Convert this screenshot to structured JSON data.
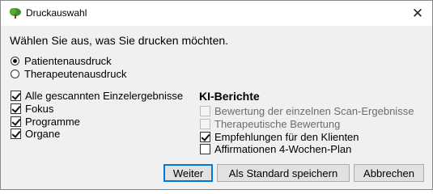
{
  "window": {
    "title": "Druckauswahl",
    "close_symbol": "✕",
    "app_icon": "green-cloud-icon"
  },
  "prompt": "Wählen Sie aus, was Sie drucken möchten.",
  "print_type": {
    "options": [
      {
        "label": "Patientenausdruck",
        "selected": true
      },
      {
        "label": "Therapeutenausdruck",
        "selected": false
      }
    ]
  },
  "left_options": [
    {
      "label": "Alle gescannten Einzelergebnisse",
      "checked": true
    },
    {
      "label": "Fokus",
      "checked": true
    },
    {
      "label": "Programme",
      "checked": true
    },
    {
      "label": "Organe",
      "checked": true
    }
  ],
  "ki_reports": {
    "heading": "KI-Berichte",
    "items": [
      {
        "label": "Bewertung der einzelnen Scan-Ergebnisse",
        "checked": false,
        "enabled": false
      },
      {
        "label": "Therapeutische Bewertung",
        "checked": false,
        "enabled": false
      },
      {
        "label": "Empfehlungen für den Klienten",
        "checked": true,
        "enabled": true
      },
      {
        "label": "Affirmationen 4-Wochen-Plan",
        "checked": false,
        "enabled": true
      }
    ]
  },
  "buttons": {
    "next": "Weiter",
    "save_default": "Als Standard speichern",
    "cancel": "Abbrechen"
  },
  "colors": {
    "dialog_bg": "#f0f0f0",
    "titlebar_bg": "#ffffff",
    "default_button_border": "#0078d7",
    "icon_green": "#3f8f2a"
  }
}
